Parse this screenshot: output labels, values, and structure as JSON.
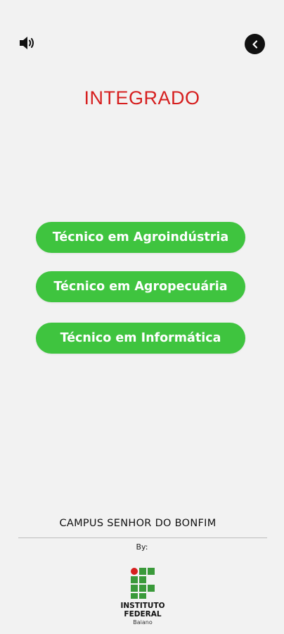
{
  "header": {
    "sound_icon": "speaker-volume-icon",
    "back_icon": "chevron-left-icon"
  },
  "title": "INTEGRADO",
  "courses": [
    {
      "label": "Técnico em Agroindústria"
    },
    {
      "label": "Técnico em Agropecuária"
    },
    {
      "label": "Técnico em Informática"
    }
  ],
  "footer": {
    "campus": "CAMPUS SENHOR DO BONFIM",
    "by": "By:",
    "logo": {
      "line1": "INSTITUTO",
      "line2": "FEDERAL",
      "line3": "Baiano"
    }
  },
  "colors": {
    "background": "#f2f2f2",
    "title": "#d61f1f",
    "button": "#3fc43f",
    "button_text": "#ffffff",
    "logo_green": "#3a9a3a",
    "logo_red": "#d61f1f"
  }
}
